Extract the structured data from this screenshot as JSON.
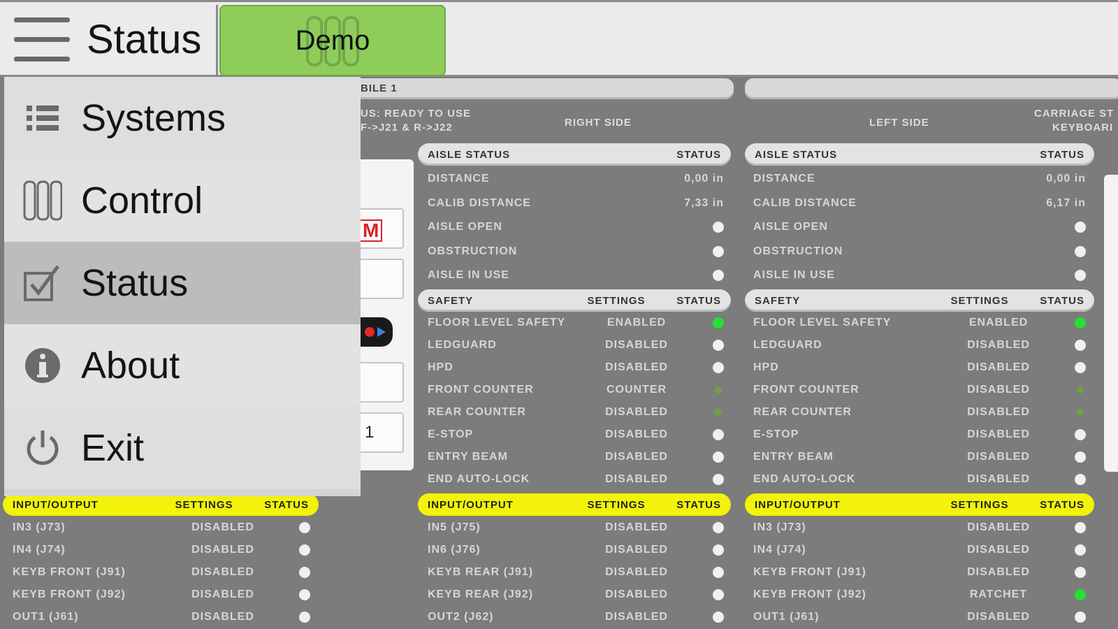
{
  "header": {
    "title": "Status",
    "demo_label": "Demo"
  },
  "menu": [
    {
      "label": "Systems",
      "icon": "list-icon"
    },
    {
      "label": "Control",
      "icon": "columns-icon"
    },
    {
      "label": "Status",
      "icon": "checkbox-icon",
      "active": true
    },
    {
      "label": "About",
      "icon": "info-icon"
    },
    {
      "label": "Exit",
      "icon": "power-icon"
    }
  ],
  "mobile_banner": "BILE 1",
  "status_line1": "US:   READY TO USE",
  "status_line2": "F->J21 & R->J22",
  "card_number": "1",
  "card_letter": "M",
  "right": {
    "side_label": "RIGHT SIDE",
    "aisle_header": {
      "c1": "AISLE STATUS",
      "c3": "STATUS"
    },
    "aisle_rows": [
      {
        "label": "DISTANCE",
        "value": "0,00 in"
      },
      {
        "label": "CALIB DISTANCE",
        "value": "7,33 in"
      },
      {
        "label": "AISLE OPEN"
      },
      {
        "label": "OBSTRUCTION"
      },
      {
        "label": "AISLE IN USE"
      }
    ],
    "safety_header": {
      "c1": "SAFETY",
      "c2": "SETTINGS",
      "c3": "STATUS"
    },
    "safety_rows": [
      {
        "label": "FLOOR LEVEL SAFETY",
        "setting": "ENABLED",
        "status": "green"
      },
      {
        "label": "LEDGUARD",
        "setting": "DISABLED",
        "status": "white"
      },
      {
        "label": "HPD",
        "setting": "DISABLED",
        "status": "white"
      },
      {
        "label": "FRONT COUNTER",
        "setting": "COUNTER",
        "status": "dim"
      },
      {
        "label": "REAR COUNTER",
        "setting": "DISABLED",
        "status": "dim"
      },
      {
        "label": "E-STOP",
        "setting": "DISABLED",
        "status": "white"
      },
      {
        "label": "ENTRY BEAM",
        "setting": "DISABLED",
        "status": "white"
      },
      {
        "label": "END AUTO-LOCK",
        "setting": "DISABLED",
        "status": "white"
      }
    ],
    "io_header": {
      "c1": "INPUT/OUTPUT",
      "c2": "SETTINGS",
      "c3": "STATUS"
    },
    "io_rows": [
      {
        "label": "IN5 (J75)",
        "setting": "DISABLED",
        "status": "white"
      },
      {
        "label": "IN6 (J76)",
        "setting": "DISABLED",
        "status": "white"
      },
      {
        "label": "KEYB REAR (J91)",
        "setting": "DISABLED",
        "status": "white"
      },
      {
        "label": "KEYB REAR (J92)",
        "setting": "DISABLED",
        "status": "white"
      },
      {
        "label": "OUT2 (J62)",
        "setting": "DISABLED",
        "status": "white"
      }
    ]
  },
  "left": {
    "side_label": "LEFT SIDE",
    "carriage_label1": "CARRIAGE ST",
    "carriage_label2": "KEYBOARI",
    "aisle_header": {
      "c1": "AISLE STATUS",
      "c3": "STATUS"
    },
    "aisle_rows": [
      {
        "label": "DISTANCE",
        "value": "0,00 in"
      },
      {
        "label": "CALIB DISTANCE",
        "value": "6,17 in"
      },
      {
        "label": "AISLE OPEN"
      },
      {
        "label": "OBSTRUCTION"
      },
      {
        "label": "AISLE IN USE"
      }
    ],
    "safety_header": {
      "c1": "SAFETY",
      "c2": "SETTINGS",
      "c3": "STATUS"
    },
    "safety_rows": [
      {
        "label": "FLOOR LEVEL SAFETY",
        "setting": "ENABLED",
        "status": "green"
      },
      {
        "label": "LEDGUARD",
        "setting": "DISABLED",
        "status": "white"
      },
      {
        "label": "HPD",
        "setting": "DISABLED",
        "status": "white"
      },
      {
        "label": "FRONT COUNTER",
        "setting": "DISABLED",
        "status": "dim"
      },
      {
        "label": "REAR COUNTER",
        "setting": "DISABLED",
        "status": "dim"
      },
      {
        "label": "E-STOP",
        "setting": "DISABLED",
        "status": "white"
      },
      {
        "label": "ENTRY BEAM",
        "setting": "DISABLED",
        "status": "white"
      },
      {
        "label": "END AUTO-LOCK",
        "setting": "DISABLED",
        "status": "white"
      }
    ],
    "io_header": {
      "c1": "INPUT/OUTPUT",
      "c2": "SETTINGS",
      "c3": "STATUS"
    },
    "io_rows": [
      {
        "label": "IN3 (J73)",
        "setting": "DISABLED",
        "status": "white"
      },
      {
        "label": "IN4 (J74)",
        "setting": "DISABLED",
        "status": "white"
      },
      {
        "label": "KEYB FRONT (J91)",
        "setting": "DISABLED",
        "status": "white"
      },
      {
        "label": "KEYB FRONT (J92)",
        "setting": "RATCHET",
        "status": "green"
      },
      {
        "label": "OUT1 (J61)",
        "setting": "DISABLED",
        "status": "white"
      }
    ]
  },
  "main_io": {
    "header": {
      "c1": "INPUT/OUTPUT",
      "c2": "SETTINGS",
      "c3": "STATUS"
    },
    "rows": [
      {
        "label": "IN3 (J73)",
        "setting": "DISABLED",
        "status": "white"
      },
      {
        "label": "IN4 (J74)",
        "setting": "DISABLED",
        "status": "white"
      },
      {
        "label": "KEYB FRONT (J91)",
        "setting": "DISABLED",
        "status": "white"
      },
      {
        "label": "KEYB FRONT (J92)",
        "setting": "DISABLED",
        "status": "white"
      },
      {
        "label": "OUT1 (J61)",
        "setting": "DISABLED",
        "status": "white"
      }
    ]
  },
  "colors": {
    "accent_green": "#8fcd5a",
    "highlight_yellow": "#f2f20a",
    "status_green": "#27e033"
  }
}
